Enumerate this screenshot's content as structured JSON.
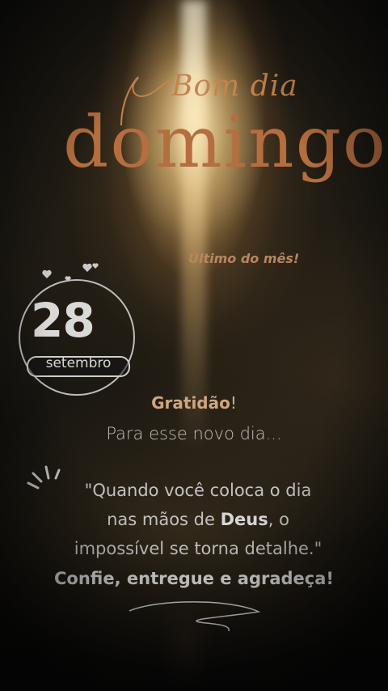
{
  "greeting": {
    "line1": "Bom dia",
    "line2": "domingo",
    "tagline": "Último do mês!"
  },
  "date": {
    "day": "28",
    "month": "setembro"
  },
  "message": {
    "gratitude_word": "Gratidão",
    "gratitude_suffix": "!",
    "subline": "Para esse novo dia...",
    "quote_line1": "\"Quando você coloca o dia",
    "quote_line2_pre": "nas mãos de ",
    "quote_line2_bold": "Deus",
    "quote_line2_post": ", o",
    "quote_line3": "impossível se torna detalhe.\"",
    "closing": "Confie, entregue e agradeça!"
  },
  "colors": {
    "accent_copper": "#b56e3f",
    "text_light": "#d7d7d7",
    "gold_text": "#cfa57f"
  },
  "icons": [
    "heart-icon",
    "sparkle-lines-icon",
    "swoosh-underline"
  ]
}
